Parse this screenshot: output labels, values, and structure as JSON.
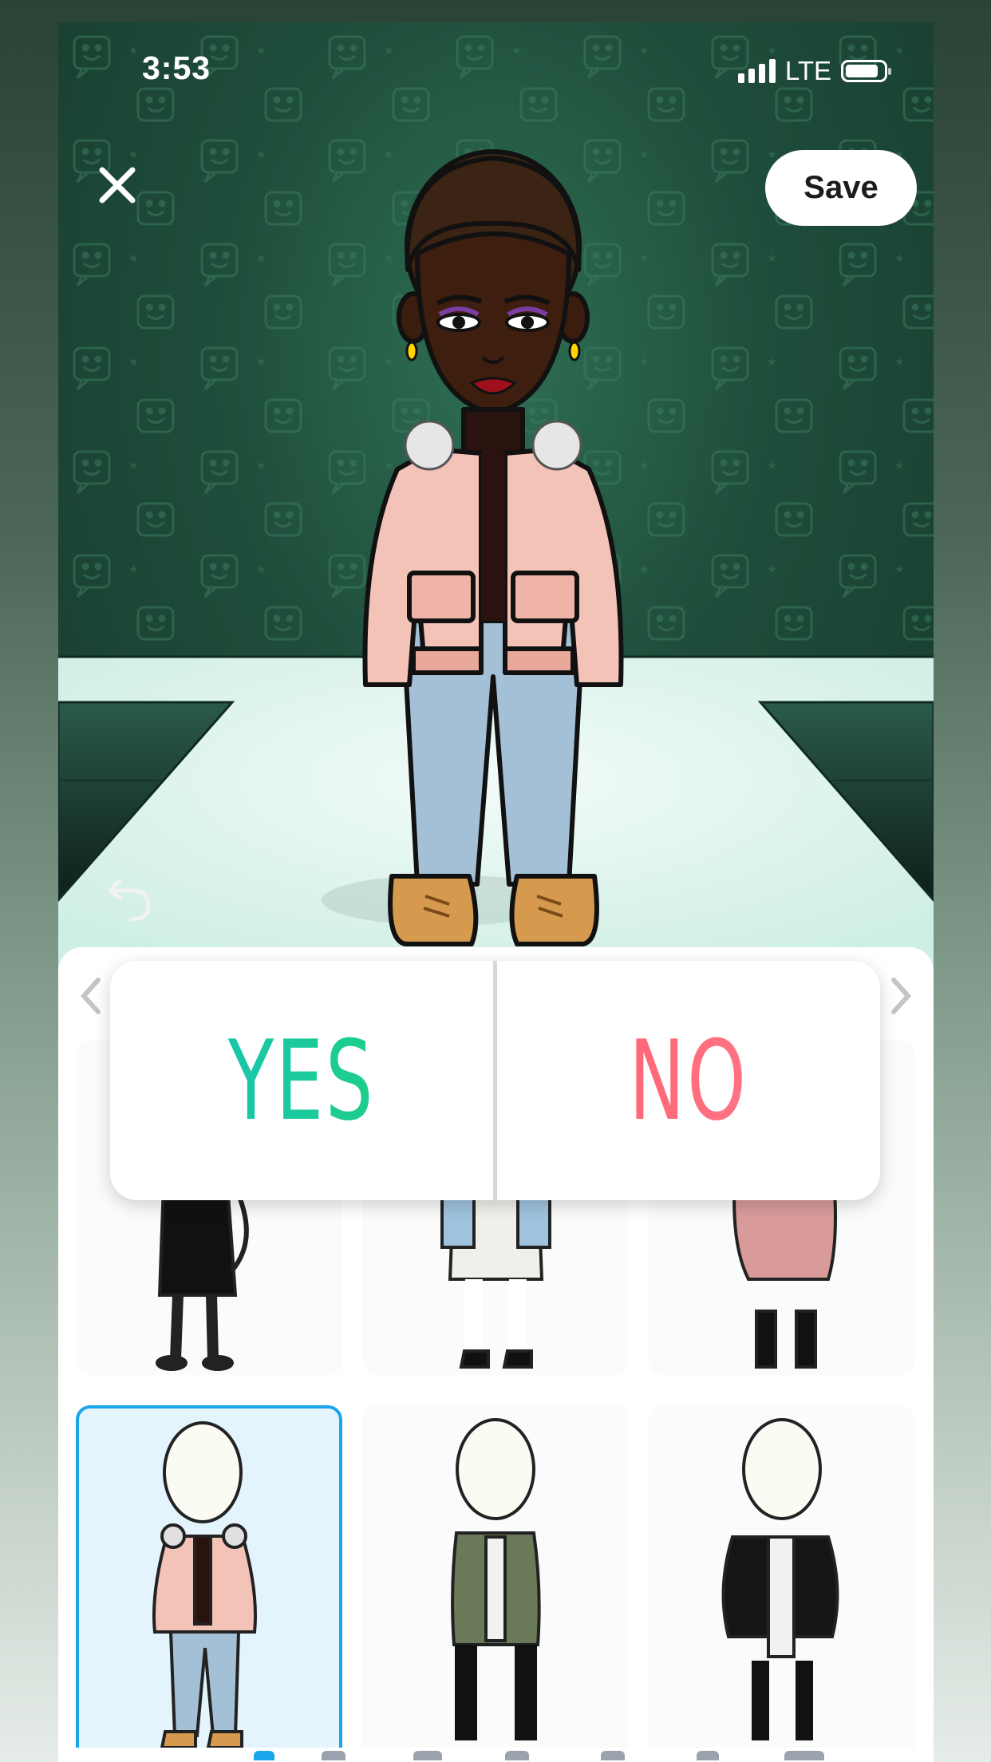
{
  "status_bar": {
    "time": "3:53",
    "network": "LTE"
  },
  "header": {
    "save_label": "Save"
  },
  "poll": {
    "yes_label": "YES",
    "no_label": "NO"
  },
  "colors": {
    "stage_bg": "#1f4d3b",
    "floor": "#dff4ee",
    "selection_border": "#1aa6ea",
    "yes_gradient": [
      "#17c3b9",
      "#1fd17d"
    ],
    "no_gradient": [
      "#ff5f6d",
      "#ff7b8e"
    ]
  },
  "outfits": [
    {
      "id": "black-sparkle-dress",
      "selected": false
    },
    {
      "id": "denim-jacket-white-skirt",
      "selected": false
    },
    {
      "id": "pink-sweater-dress",
      "selected": false
    },
    {
      "id": "pink-fur-jacket-jeans",
      "selected": true
    },
    {
      "id": "green-parka-black-pants",
      "selected": false
    },
    {
      "id": "black-puffer-white-skirt",
      "selected": false
    }
  ],
  "icons": [
    "close-icon",
    "undo-icon",
    "chevron-left-icon",
    "chevron-right-icon",
    "battery-icon",
    "signal-icon"
  ]
}
